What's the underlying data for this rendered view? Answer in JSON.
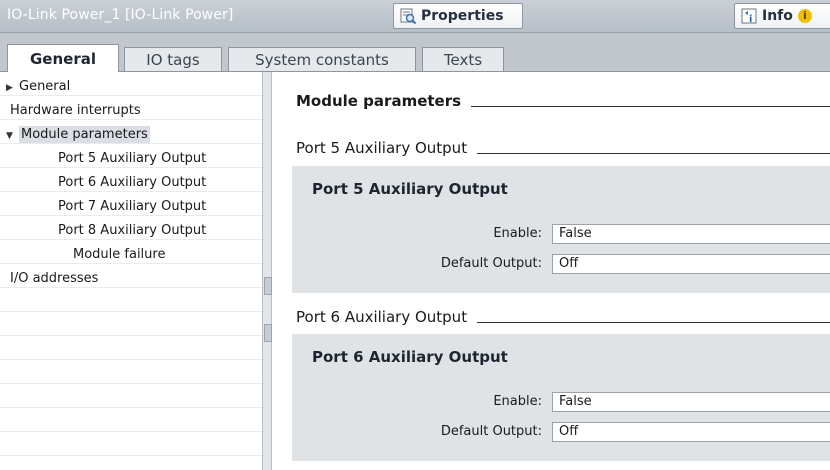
{
  "window": {
    "title": "IO-Link Power_1 [IO-Link Power]",
    "properties_tab": "Properties",
    "info_tab": "Info",
    "icons": {
      "properties": "properties-icon",
      "info": "info-icon",
      "info_badge": "info-badge-icon"
    }
  },
  "tabs": [
    {
      "label": "General"
    },
    {
      "label": "IO tags"
    },
    {
      "label": "System constants"
    },
    {
      "label": "Texts"
    }
  ],
  "nav": {
    "items": [
      {
        "label": "General"
      },
      {
        "label": "Hardware interrupts"
      },
      {
        "label": "Module parameters"
      },
      {
        "label": "Port 5 Auxiliary Output"
      },
      {
        "label": "Port 6 Auxiliary Output"
      },
      {
        "label": "Port 7 Auxiliary Output"
      },
      {
        "label": "Port 8 Auxiliary Output"
      },
      {
        "label": "Module failure"
      },
      {
        "label": "I/O addresses"
      }
    ]
  },
  "main": {
    "heading": "Module parameters",
    "sections": [
      {
        "heading": "Port 5 Auxiliary Output",
        "group_title": "Port 5 Auxiliary Output",
        "enable_label": "Enable:",
        "enable_value": "False",
        "default_label": "Default Output:",
        "default_value": "Off"
      },
      {
        "heading": "Port 6 Auxiliary Output",
        "group_title": "Port 6 Auxiliary Output",
        "enable_label": "Enable:",
        "enable_value": "False",
        "default_label": "Default Output:",
        "default_value": "Off"
      }
    ]
  },
  "colors": {
    "accent_info": "#f0c000",
    "selection": "#d9dfe5",
    "group_bg": "#e0e3e6"
  }
}
